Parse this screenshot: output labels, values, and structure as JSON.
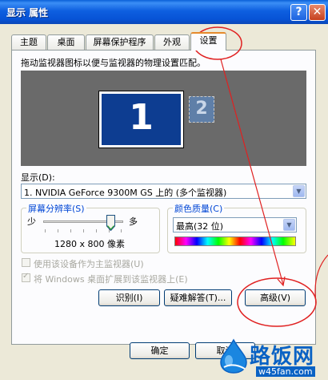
{
  "window": {
    "title": "显示 属性",
    "help_symbol": "?",
    "close_symbol": "✕"
  },
  "tabs": [
    {
      "label": "主题",
      "active": false
    },
    {
      "label": "桌面",
      "active": false
    },
    {
      "label": "屏幕保护程序",
      "active": false
    },
    {
      "label": "外观",
      "active": false
    },
    {
      "label": "设置",
      "active": true
    }
  ],
  "settings": {
    "instruction": "拖动监视器图标以便与监视器的物理设置匹配。",
    "monitor1_label": "1",
    "monitor2_label": "2",
    "display_label": "显示(D):",
    "display_value": "1. NVIDIA GeForce 9300M GS 上的 (多个监视器)",
    "resolution": {
      "title": "屏幕分辨率(S)",
      "less_label": "少",
      "more_label": "多",
      "value": "1280 x 800 像素"
    },
    "color_quality": {
      "title": "颜色质量(C)",
      "value": "最高(32 位)"
    },
    "checkbox_primary": {
      "label": "使用该设备作为主监视器(U)",
      "checked": false
    },
    "checkbox_extend": {
      "label": "将 Windows 桌面扩展到该监视器上(E)",
      "checked": true
    },
    "buttons": {
      "identify": "识别(I)",
      "troubleshoot": "疑难解答(T)...",
      "advanced": "高级(V)"
    }
  },
  "footer": {
    "ok": "确定",
    "cancel": "取消"
  },
  "watermark": {
    "text": "路饭网",
    "url": "w45fan.com"
  },
  "colors": {
    "title_bar": "#0753d6",
    "dialog_bg": "#ece9d8",
    "monitor_area": "#6a6a6a",
    "monitor_primary": "#0d3d91",
    "group_title": "#0046d5",
    "annotation_red": "#e02020",
    "watermark_blue": "#0a62c4"
  }
}
